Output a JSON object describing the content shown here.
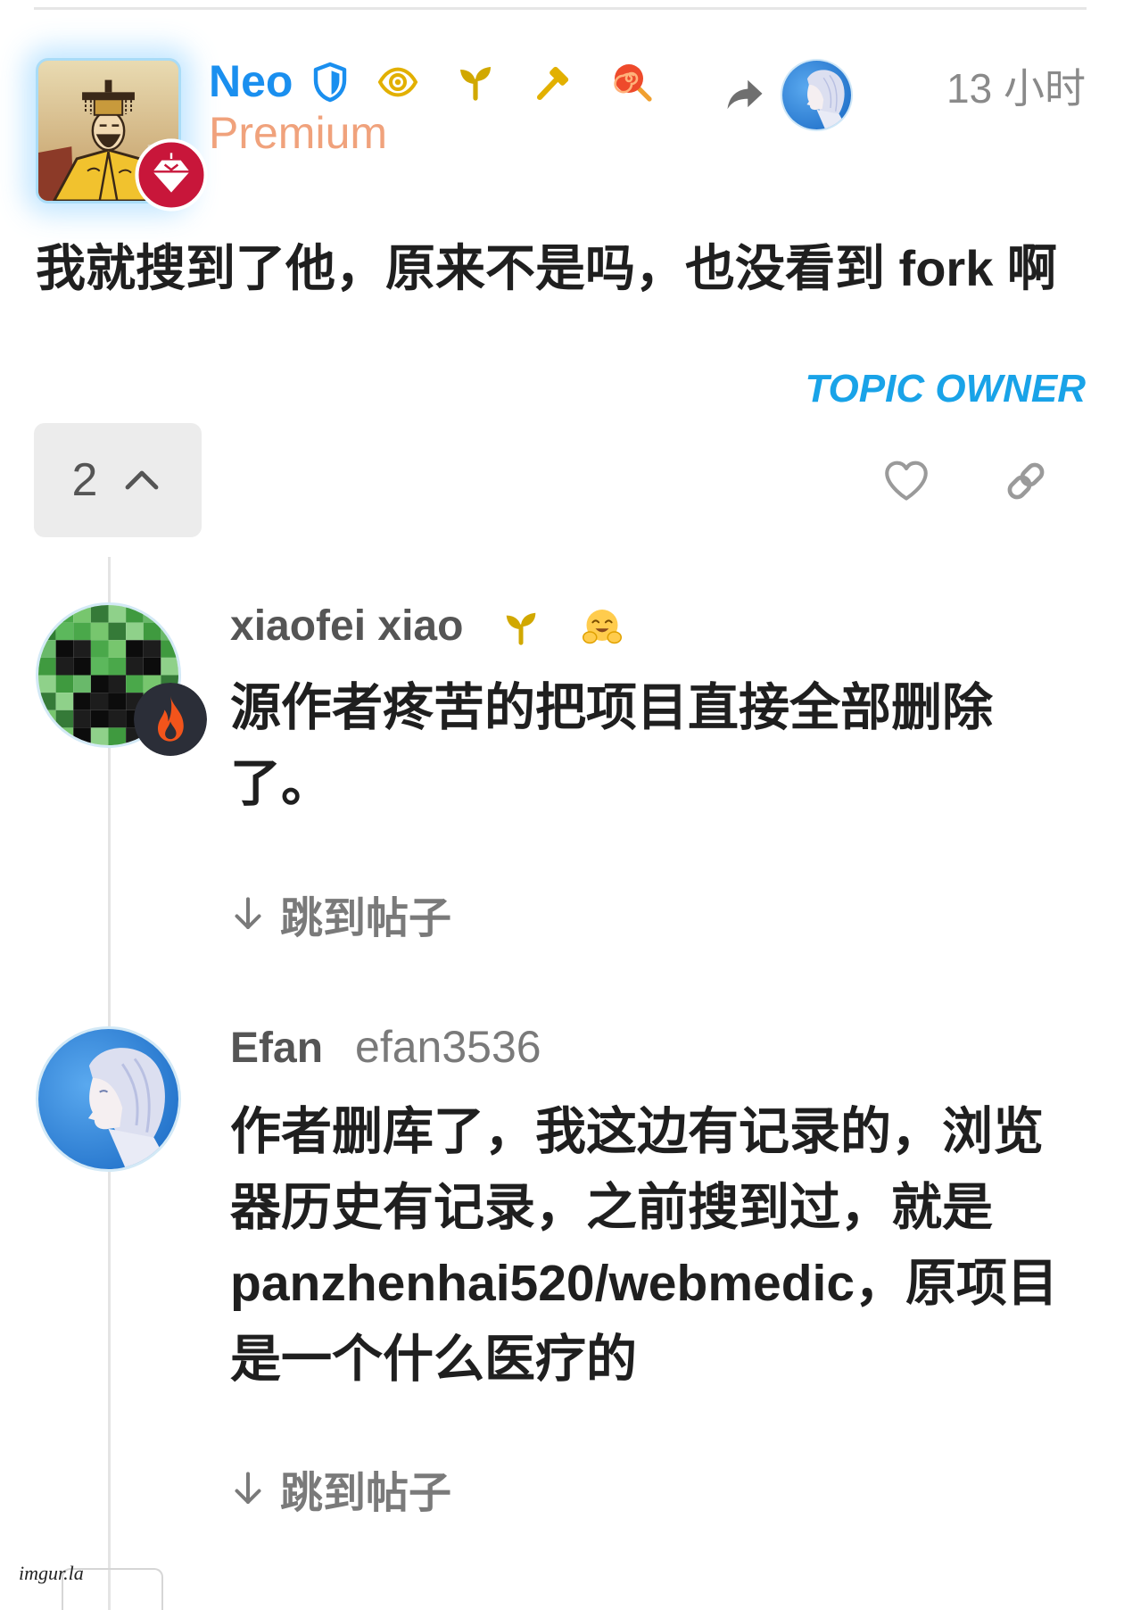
{
  "post": {
    "author_name": "Neo",
    "author_title": "Premium",
    "avatar_icon": "emperor-avatar",
    "avatar_badge_icon": "diamond-badge-icon",
    "flair_icons": [
      "shield-icon",
      "eye-icon",
      "sprout-icon",
      "hammer-icon",
      "lollipop-icon"
    ],
    "reply_to_icon": "reply-arrow-icon",
    "reply_to_avatar_icon": "reply-to-user-avatar",
    "time": "13 小时",
    "body": "我就搜到了他，原来不是吗，也没看到 fork 啊",
    "owner_label": "TOPIC OWNER",
    "replies_count": "2",
    "replies_toggle_icon": "chevron-up-icon",
    "like_icon": "heart-icon",
    "copy_link_icon": "link-icon"
  },
  "replies": [
    {
      "name": "xiaofei xiao",
      "avatar_icon": "creeper-avatar",
      "avatar_badge_icon": "fire-badge-icon",
      "flair_icons": [
        "sprout-icon",
        "hugging-face-emoji"
      ],
      "body": "源作者疼苦的把项目直接全部删除了。",
      "jump_icon": "arrow-down-icon",
      "jump_label": "跳到帖子"
    },
    {
      "name": "Efan",
      "username": "efan3536",
      "avatar_icon": "anime-portrait-avatar",
      "body": "作者删库了，我这边有记录的，浏览器历史有记录，之前搜到过，就是 panzhenhai520/webmedic，原项目是一个什么医疗的",
      "jump_icon": "arrow-down-icon",
      "jump_label": "跳到帖子"
    }
  ],
  "watermark": "imgur.la",
  "colors": {
    "author_name": "#1a8fef",
    "premium_title": "#f0a27c",
    "topic_owner": "#19a3e8",
    "body_text": "#1f1f1f",
    "muted_text": "#7a7a7a",
    "flair_gold": "#e2b000",
    "badge_red": "#c8163a",
    "toggle_bg": "#ececec"
  }
}
